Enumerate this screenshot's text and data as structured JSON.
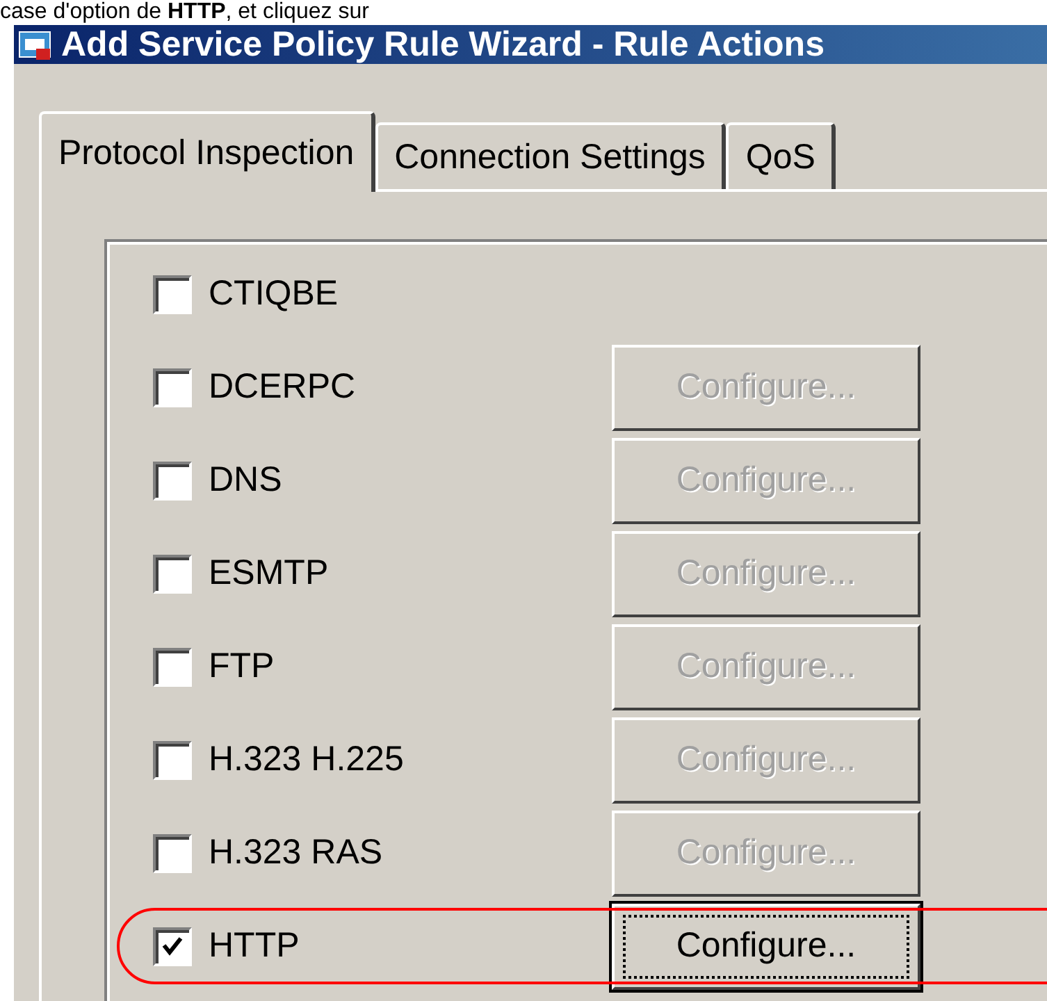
{
  "caption": "case d'option de **HTTP**, et cliquez sur",
  "window": {
    "title": "Add Service Policy Rule Wizard - Rule Actions"
  },
  "tabs": [
    {
      "label": "Protocol Inspection",
      "selected": true
    },
    {
      "label": "Connection Settings",
      "selected": false
    },
    {
      "label": "QoS",
      "selected": false
    }
  ],
  "protocols": [
    {
      "label": "CTIQBE",
      "checked": false,
      "highlighted": false
    },
    {
      "label": "DCERPC",
      "checked": false,
      "highlighted": false,
      "button": {
        "label": "Configure...",
        "disabled": true
      }
    },
    {
      "label": "DNS",
      "checked": false,
      "highlighted": false,
      "button": {
        "label": "Configure...",
        "disabled": true
      }
    },
    {
      "label": "ESMTP",
      "checked": false,
      "highlighted": false,
      "button": {
        "label": "Configure...",
        "disabled": true
      }
    },
    {
      "label": "FTP",
      "checked": false,
      "highlighted": false,
      "button": {
        "label": "Configure...",
        "disabled": true
      }
    },
    {
      "label": "H.323 H.225",
      "checked": false,
      "highlighted": false,
      "button": {
        "label": "Configure...",
        "disabled": true
      }
    },
    {
      "label": "H.323 RAS",
      "checked": false,
      "highlighted": false,
      "button": {
        "label": "Configure...",
        "disabled": true
      }
    },
    {
      "label": "HTTP",
      "checked": true,
      "highlighted": true,
      "button": {
        "label": "Configure...",
        "disabled": false
      }
    }
  ]
}
